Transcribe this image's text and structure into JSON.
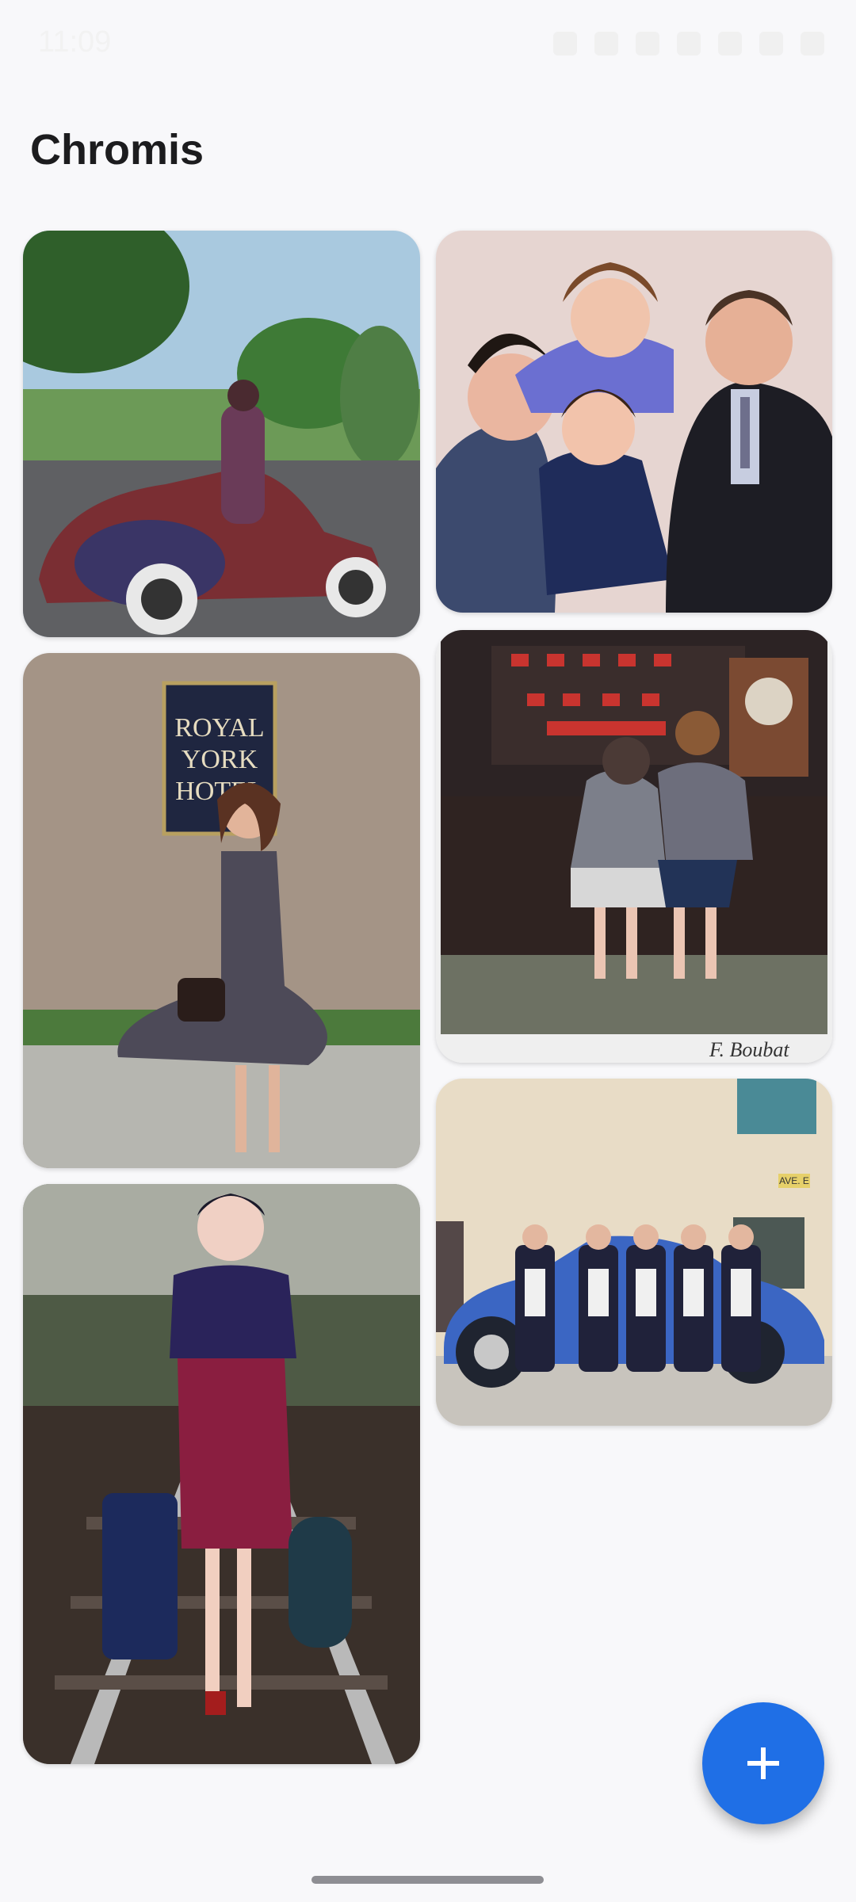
{
  "status_bar": {
    "time": "11:09"
  },
  "app": {
    "title": "Chromis"
  },
  "gallery": {
    "tiles": [
      {
        "name": "vintage-car-woman-photo"
      },
      {
        "name": "family-portrait-photo"
      },
      {
        "name": "hotel-sign-woman-photo",
        "sign_lines": [
          "ROYAL",
          "YORK",
          "HOTEL"
        ]
      },
      {
        "name": "children-shop-window-photo",
        "signature": "F. Boubat"
      },
      {
        "name": "railway-woman-suitcases-photo"
      },
      {
        "name": "women-blue-car-photo",
        "street_sign": "AVE. E"
      }
    ]
  },
  "fab": {
    "icon": "plus-icon",
    "label": "+"
  },
  "colors": {
    "accent": "#1f6fe6",
    "background": "#f8f8fa",
    "title": "#1c1c1e"
  }
}
